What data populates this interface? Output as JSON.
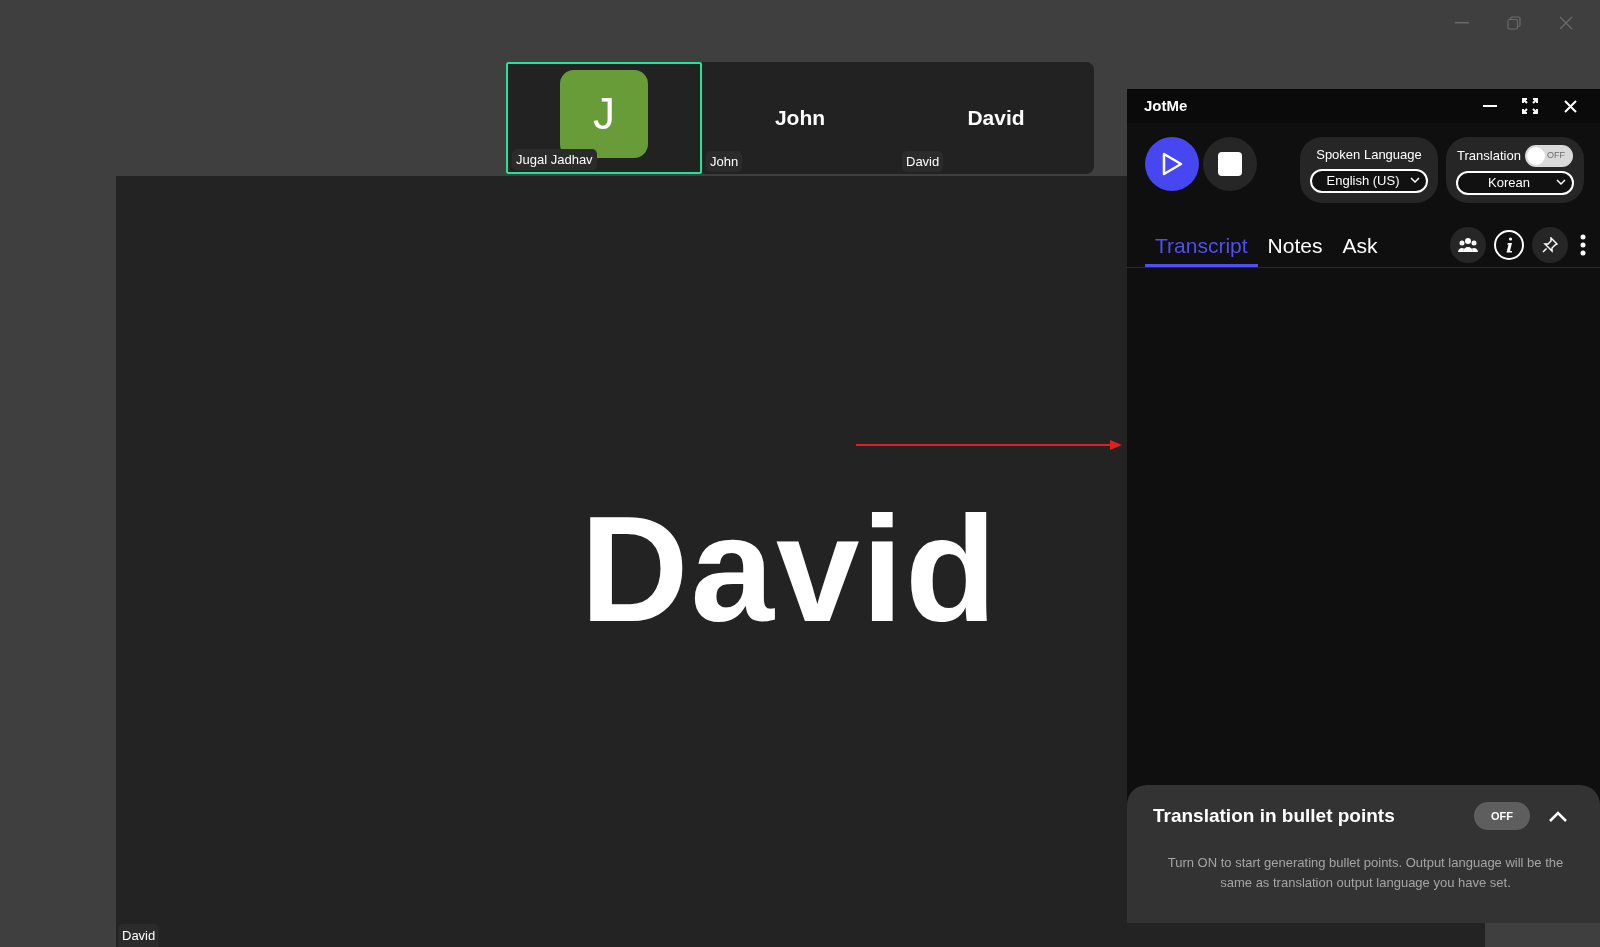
{
  "participants": [
    {
      "kind": "avatar",
      "letter": "J",
      "name": "Jugal Jadhav",
      "selected": true
    },
    {
      "kind": "name",
      "display": "John",
      "name": "John",
      "selected": false
    },
    {
      "kind": "name",
      "display": "David",
      "name": "David",
      "selected": false
    }
  ],
  "main_video": {
    "display": "David",
    "name": "David"
  },
  "jotme": {
    "title": "JotMe",
    "spoken_language": {
      "label": "Spoken Language",
      "value": "English (US)"
    },
    "translation": {
      "label": "Translation",
      "on": false,
      "toggle_text": "OFF",
      "value": "Korean"
    },
    "tabs": [
      {
        "label": "Transcript",
        "selected": true
      },
      {
        "label": "Notes",
        "selected": false
      },
      {
        "label": "Ask",
        "selected": false
      }
    ],
    "bullet_panel": {
      "title": "Translation in bullet points",
      "on": false,
      "toggle_text": "OFF",
      "expanded": true,
      "description": "Turn ON to start generating bullet points. Output language will be the same as translation output language you have set."
    }
  }
}
